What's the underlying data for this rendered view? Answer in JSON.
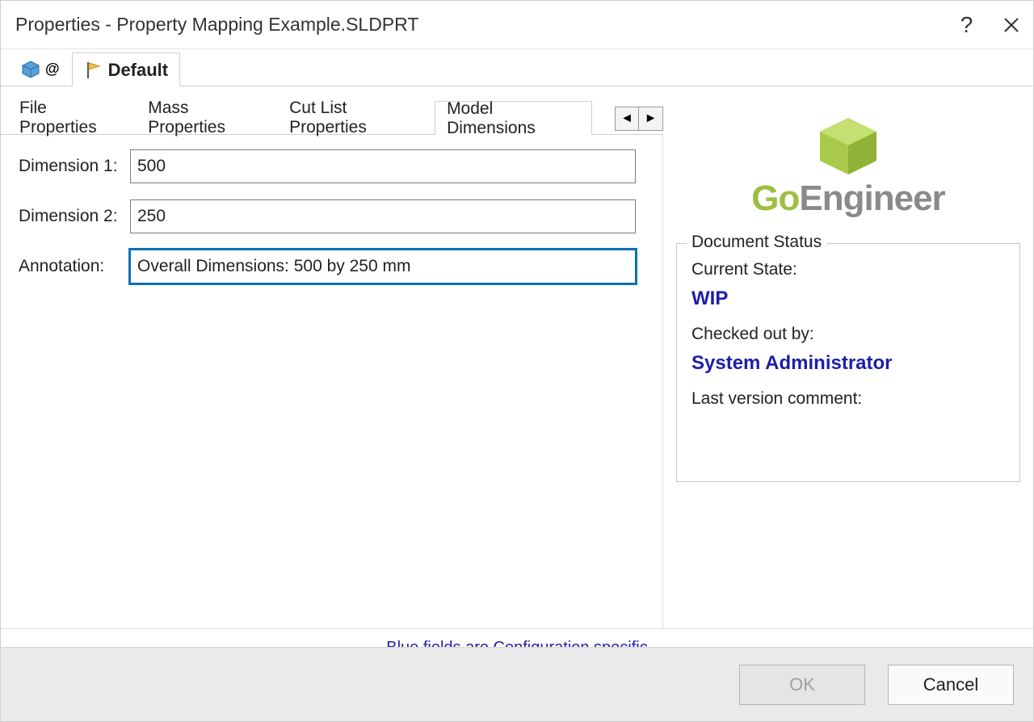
{
  "window": {
    "title": "Properties - Property Mapping Example.SLDPRT"
  },
  "topTabs": {
    "configAt": "@",
    "default": "Default"
  },
  "subTabs": {
    "t1": "File Properties",
    "t2": "Mass Properties",
    "t3": "Cut List Properties",
    "t4": "Model Dimensions"
  },
  "form": {
    "dim1_label": "Dimension 1:",
    "dim1_value": "500",
    "dim2_label": "Dimension 2:",
    "dim2_value": "250",
    "annot_label": "Annotation:",
    "annot_value": "Overall Dimensions: 500 by 250 mm"
  },
  "logo": {
    "go": "Go",
    "eng": "Engineer"
  },
  "status": {
    "legend": "Document Status",
    "currentState_label": "Current State:",
    "currentState_value": "WIP",
    "checkedOut_label": "Checked out by:",
    "checkedOut_value": "System Administrator",
    "lastComment_label": "Last version comment:"
  },
  "hint": "Blue fields are Configuration specific",
  "buttons": {
    "ok": "OK",
    "cancel": "Cancel"
  }
}
